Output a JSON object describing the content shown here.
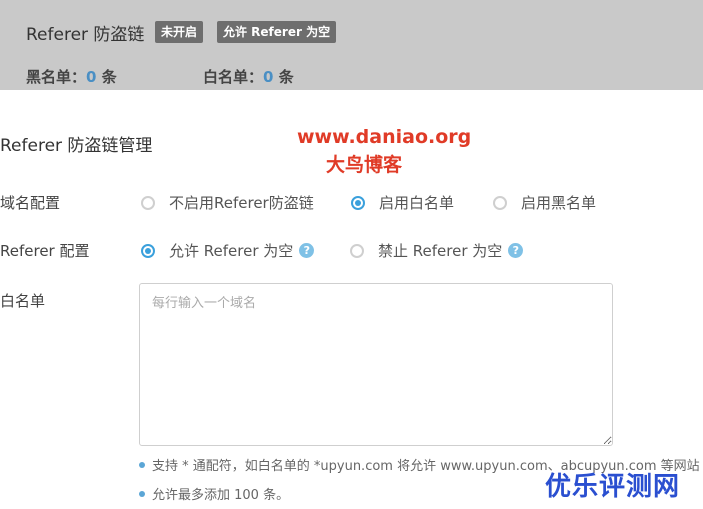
{
  "header": {
    "title": "Referer 防盗链",
    "status_badge": "未开启",
    "mode_badge": "允许 Referer 为空",
    "blacklist_label": "黑名单：",
    "blacklist_count": "0",
    "whitelist_label": "白名单：",
    "whitelist_count": "0",
    "count_unit": "条"
  },
  "section": {
    "title": "Referer 防盗链管理"
  },
  "watermark": {
    "url": "www.daniao.org",
    "name": "大鸟博客",
    "corner": "优乐评测网"
  },
  "domain_config": {
    "label": "域名配置",
    "options": [
      {
        "label": "不启用Referer防盗链",
        "selected": false
      },
      {
        "label": "启用白名单",
        "selected": true
      },
      {
        "label": "启用黑名单",
        "selected": false
      }
    ]
  },
  "referer_config": {
    "label": "Referer 配置",
    "options": [
      {
        "label": "允许 Referer 为空",
        "selected": true,
        "help_icon": "question-icon"
      },
      {
        "label": "禁止 Referer 为空",
        "selected": false,
        "help_icon": "question-icon"
      }
    ]
  },
  "whitelist": {
    "label": "白名单",
    "value": "",
    "placeholder": "每行输入一个域名"
  },
  "hints": [
    "支持 * 通配符，如白名单的 *upyun.com 将允许 www.upyun.com、abcupyun.com 等网站",
    "允许最多添加 100 条。"
  ],
  "colors": {
    "accent": "#3aa0dc",
    "header_bg": "#c9c9c9",
    "badge_bg": "#6e6e6e",
    "watermark_red": "#e03b27",
    "watermark_blue": "#2a4fd0"
  }
}
